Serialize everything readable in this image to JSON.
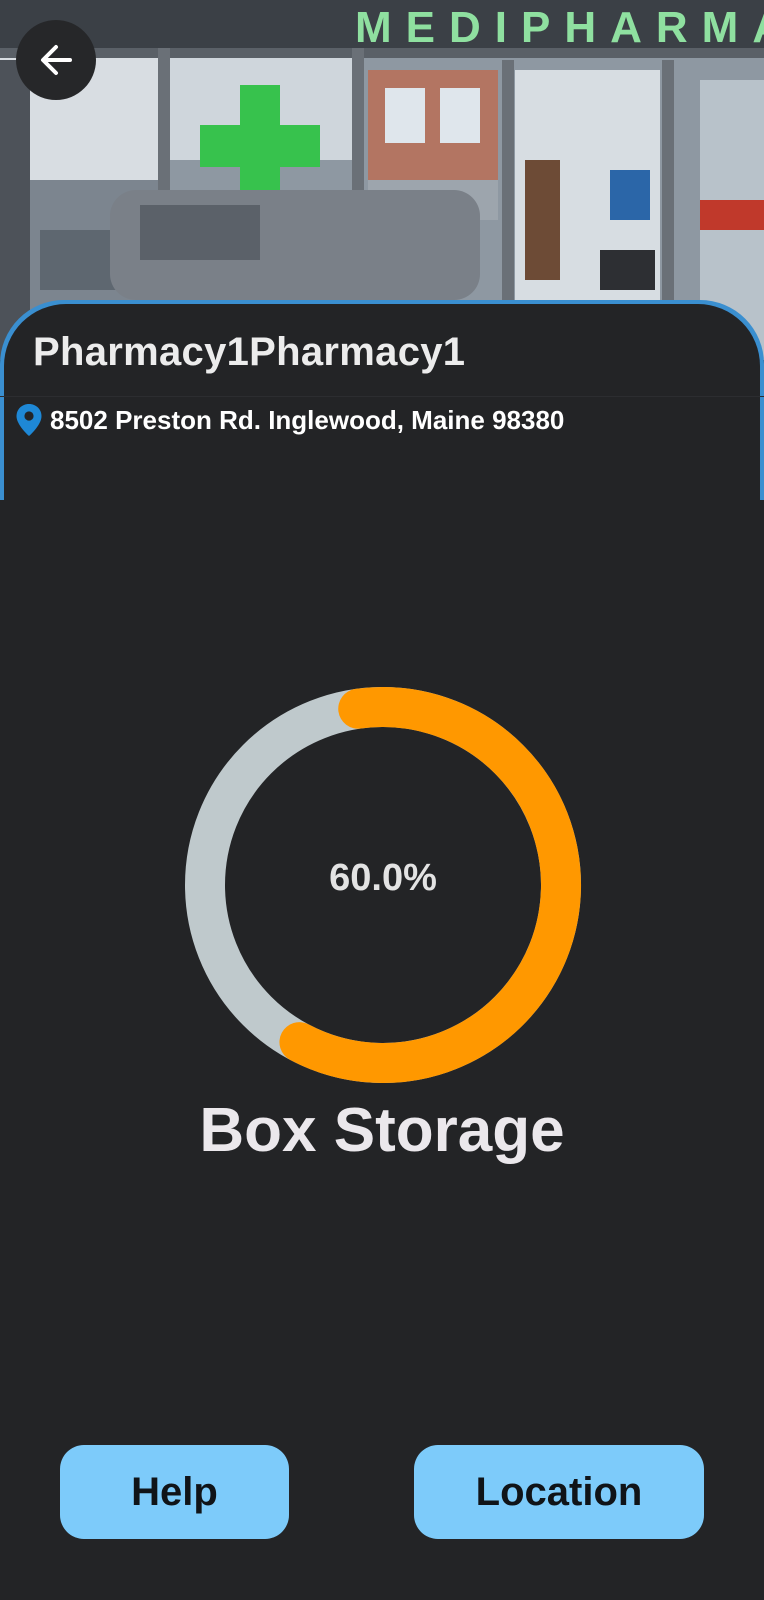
{
  "header": {
    "back_icon": "arrow-left-icon",
    "storefront_sign": "MEDIPHARMACY"
  },
  "pharmacy": {
    "name": "Pharmacy1Pharmacy1",
    "address": "8502 Preston Rd. Inglewood, Maine 98380",
    "address_icon": "location-pin-icon"
  },
  "storage": {
    "value_text": "60.0%",
    "fill_fraction": 0.6,
    "label": "Box Storage"
  },
  "actions": {
    "help_label": "Help",
    "location_label": "Location"
  },
  "colors": {
    "background": "#232426",
    "gauge_fill": "#ff9800",
    "gauge_track": "#bfc9cc",
    "button": "#7dcbfa",
    "pin": "#1e88d6",
    "card_border": "#3a8fd0"
  }
}
